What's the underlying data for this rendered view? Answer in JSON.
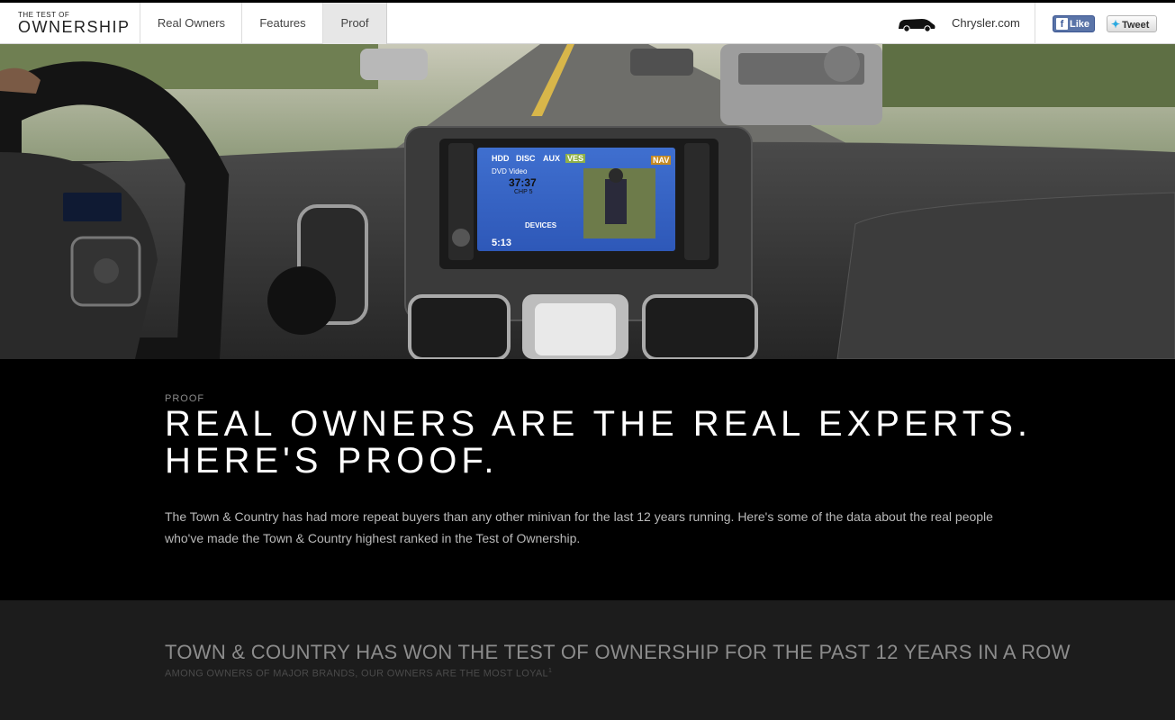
{
  "logo": {
    "small": "THE TEST OF",
    "big": "OWNERSHIP"
  },
  "nav": {
    "items": [
      "Real Owners",
      "Features",
      "Proof"
    ],
    "active": "Proof"
  },
  "header": {
    "chrysler_link": "Chrysler.com",
    "like_label": "Like",
    "tweet_label": "Tweet"
  },
  "hero": {
    "screen_tabs": [
      "HDD",
      "DISC",
      "AUX",
      "VES"
    ],
    "nav_label": "NAV",
    "dvd_label": "DVD Video",
    "time_counter": "37:37",
    "chapter": "CHP 5",
    "devices_label": "DEVICES",
    "clock": "5:13"
  },
  "proof": {
    "kicker": "PROOF",
    "headline_line1": "REAL OWNERS ARE THE REAL EXPERTS.",
    "headline_line2": "HERE'S PROOF.",
    "body": "The Town & Country has had more repeat buyers than any other minivan for the last 12 years running. Here's some of the data about the real people who've made the Town & Country highest ranked in the Test of Ownership."
  },
  "section": {
    "title": "TOWN & COUNTRY HAS WON THE TEST OF OWNERSHIP FOR THE PAST 12 YEARS IN A ROW",
    "subtitle": "AMONG OWNERS OF MAJOR BRANDS, OUR OWNERS ARE THE MOST LOYAL",
    "footnote": "1"
  },
  "colors": {
    "accent": "#000000",
    "facebook": "#3b5998",
    "twitter": "#2aa9e0"
  }
}
